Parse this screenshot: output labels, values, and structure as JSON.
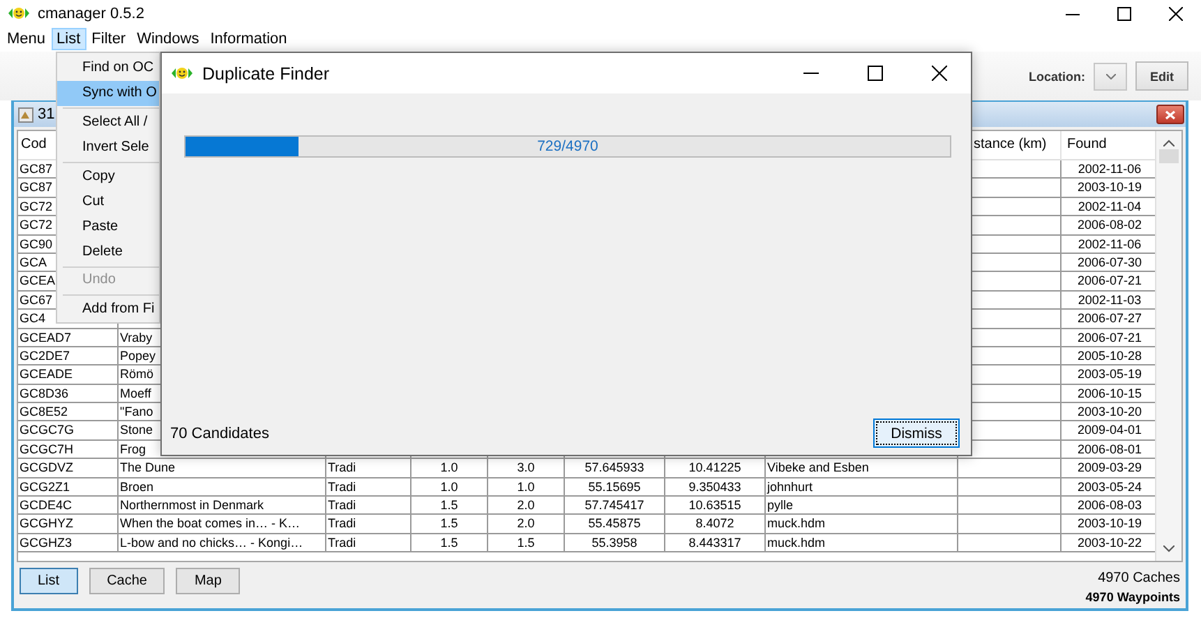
{
  "window": {
    "title": "cmanager 0.5.2"
  },
  "menu_bar": [
    {
      "label": "Menu",
      "selected": false
    },
    {
      "label": "List",
      "selected": true
    },
    {
      "label": "Filter",
      "selected": false
    },
    {
      "label": "Windows",
      "selected": false
    },
    {
      "label": "Information",
      "selected": false
    }
  ],
  "list_menu": [
    {
      "kind": "item",
      "label": "Find on OC",
      "selected": false,
      "disabled": false
    },
    {
      "kind": "item",
      "label": "Sync with O",
      "selected": true,
      "disabled": false
    },
    {
      "kind": "separator"
    },
    {
      "kind": "item",
      "label": "Select All /",
      "selected": false,
      "disabled": false
    },
    {
      "kind": "item",
      "label": "Invert Sele",
      "selected": false,
      "disabled": false
    },
    {
      "kind": "separator"
    },
    {
      "kind": "item",
      "label": "Copy",
      "selected": false,
      "disabled": false
    },
    {
      "kind": "item",
      "label": "Cut",
      "selected": false,
      "disabled": false
    },
    {
      "kind": "item",
      "label": "Paste",
      "selected": false,
      "disabled": false
    },
    {
      "kind": "item",
      "label": "Delete",
      "selected": false,
      "disabled": false
    },
    {
      "kind": "separator"
    },
    {
      "kind": "item",
      "label": "Undo",
      "selected": false,
      "disabled": true
    },
    {
      "kind": "separator"
    },
    {
      "kind": "item",
      "label": "Add from Fi",
      "selected": false,
      "disabled": false
    }
  ],
  "toolbar": {
    "location_label": "Location:",
    "edit_button": "Edit"
  },
  "list_frame": {
    "title": "31",
    "header": {
      "column_1": "Cod",
      "column_9": "stance (km)",
      "column_10": "Found"
    },
    "rows": [
      {
        "column_1": "GC87",
        "column_10": "2002-11-06"
      },
      {
        "column_1": "GC87",
        "column_10": "2003-10-19"
      },
      {
        "column_1": "GC72",
        "column_10": "2002-11-04"
      },
      {
        "column_1": "GC72",
        "column_10": "2006-08-02"
      },
      {
        "column_1": "GC90",
        "column_10": "2002-11-06"
      },
      {
        "column_1": "GCA",
        "column_10": "2006-07-30"
      },
      {
        "column_1": "GCEA",
        "column_10": "2006-07-21"
      },
      {
        "column_1": "GC67",
        "column_10": "2002-11-03"
      },
      {
        "column_1": "GC4",
        "column_10": "2006-07-27"
      },
      {
        "column_1": "GCEAD7",
        "column_2": "Vraby",
        "column_10": "2006-07-21"
      },
      {
        "column_1": "GC2DE7",
        "column_2": "Popey",
        "column_10": "2005-10-28"
      },
      {
        "column_1": "GCEADE",
        "column_2": "Römö",
        "column_10": "2003-05-19"
      },
      {
        "column_1": "GC8D36",
        "column_2": "Moeff",
        "column_10": "2006-10-15"
      },
      {
        "column_1": "GC8E52",
        "column_2": "\"Fano",
        "column_10": "2003-10-20"
      },
      {
        "column_1": "GCGC7G",
        "column_2": "Stone",
        "column_10": "2009-04-01"
      },
      {
        "column_1": "GCGC7H",
        "column_2": "Frog",
        "column_10": "2006-08-01"
      },
      {
        "column_1": "GCGDVZ",
        "column_2": "The Dune",
        "column_3": "Tradi",
        "column_4": "1.0",
        "column_5": "3.0",
        "column_6": "57.645933",
        "column_7": "10.41225",
        "column_8": "Vibeke and Esben",
        "column_10": "2009-03-29"
      },
      {
        "column_1": "GCG2Z1",
        "column_2": "Broen",
        "column_3": "Tradi",
        "column_4": "1.0",
        "column_5": "1.0",
        "column_6": "55.15695",
        "column_7": "9.350433",
        "column_8": "johnhurt",
        "column_10": "2003-05-24"
      },
      {
        "column_1": "GCDE4C",
        "column_2": "Northernmost in Denmark",
        "column_3": "Tradi",
        "column_4": "1.5",
        "column_5": "2.0",
        "column_6": "57.745417",
        "column_7": "10.63515",
        "column_8": "pylle",
        "column_10": "2006-08-03"
      },
      {
        "column_1": "GCGHYZ",
        "column_2": "When the boat comes in… - K…",
        "column_3": "Tradi",
        "column_4": "1.5",
        "column_5": "2.0",
        "column_6": "55.45875",
        "column_7": "8.4072",
        "column_8": "muck.hdm",
        "column_10": "2003-10-19"
      },
      {
        "column_1": "GCGHZ3",
        "column_2": "L-bow and no chicks… - Kongi…",
        "column_3": "Tradi",
        "column_4": "1.5",
        "column_5": "1.5",
        "column_6": "55.3958",
        "column_7": "8.443317",
        "column_8": "muck.hdm",
        "column_10": "2003-10-22"
      }
    ],
    "view_buttons": [
      {
        "label": "List",
        "selected": true
      },
      {
        "label": "Cache",
        "selected": false
      },
      {
        "label": "Map",
        "selected": false
      }
    ],
    "cache_count": "4970  Caches",
    "waypoint_count": "4970 Waypoints"
  },
  "dialog": {
    "title": "Duplicate Finder",
    "progress": {
      "level": 0.147,
      "reading": "729/4970"
    },
    "candidates": "70  Candidates",
    "dismiss_button": "Dismiss"
  }
}
